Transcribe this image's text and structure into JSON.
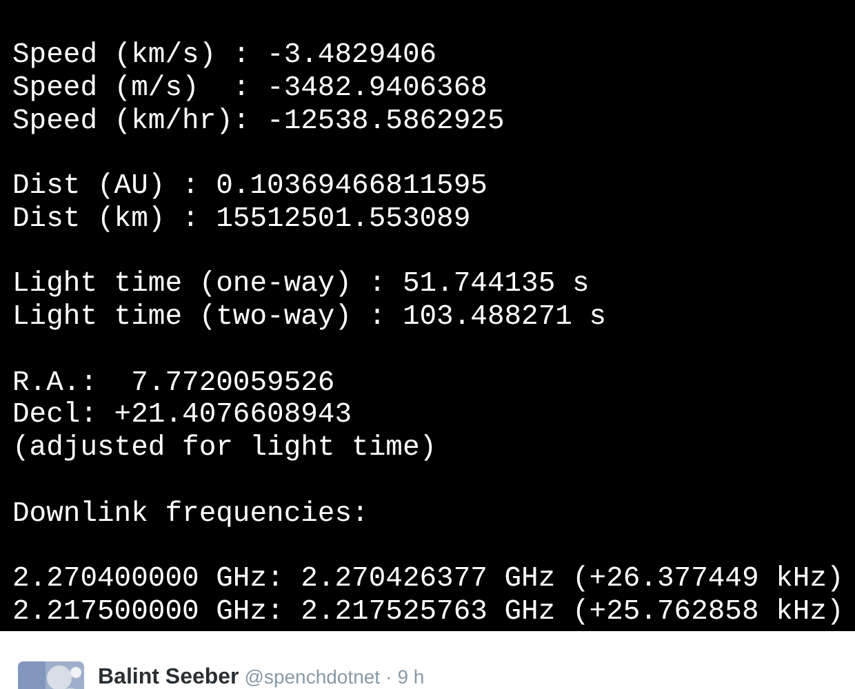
{
  "terminal": {
    "blocks": [
      [
        "Speed (km/s) : -3.4829406",
        "Speed (m/s)  : -3482.9406368",
        "Speed (km/hr): -12538.5862925"
      ],
      [
        "Dist (AU) : 0.10369466811595",
        "Dist (km) : 15512501.553089"
      ],
      [
        "Light time (one-way) : 51.744135 s",
        "Light time (two-way) : 103.488271 s"
      ],
      [
        "R.A.:  7.7720059526",
        "Decl: +21.4076608943",
        "(adjusted for light time)"
      ],
      [
        "Downlink frequencies:"
      ],
      [
        "2.270400000 GHz: 2.270426377 GHz (+26.377449 kHz)",
        "2.217500000 GHz: 2.217525763 GHz (+25.762858 kHz)"
      ]
    ]
  },
  "tweet": {
    "name": "Balint Seeber",
    "handle": "@spenchdotnet",
    "separator": "·",
    "time": "9 h"
  }
}
